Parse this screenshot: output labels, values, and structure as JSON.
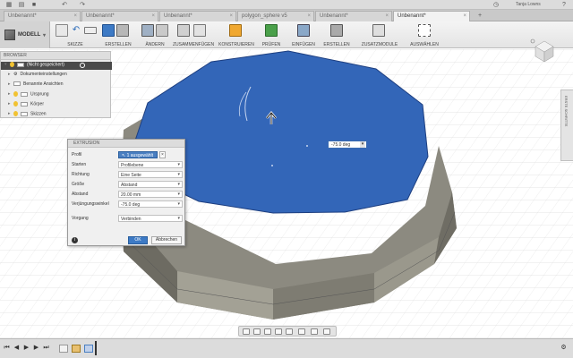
{
  "user_name": "Tanja Lowns",
  "tabs": [
    {
      "label": "Unbenannt*",
      "active": false
    },
    {
      "label": "Unbenannt*",
      "active": false
    },
    {
      "label": "Unbenannt*",
      "active": false
    },
    {
      "label": "polygon_sphere v5",
      "active": false
    },
    {
      "label": "Unbenannt*",
      "active": false
    },
    {
      "label": "Unbenannt*",
      "active": true
    }
  ],
  "toolbar": {
    "workspace": "MODELL",
    "groups": [
      "SKIZZE",
      "ERSTELLEN",
      "ÄNDERN",
      "ZUSAMMENFÜGEN",
      "KONSTRUIEREN",
      "PRÜFEN",
      "EINFÜGEN",
      "ERSTELLEN",
      "ZUSATZMODULE",
      "AUSWÄHLEN"
    ]
  },
  "browser": {
    "title": "BROWSER",
    "root": "(Nicht gespeichert)",
    "items": [
      "Dokumenteinstellungen",
      "Benannte Ansichten",
      "Ursprung",
      "Körper",
      "Skizzen"
    ]
  },
  "dialog": {
    "title": "EXTRUSION",
    "rows": [
      {
        "label": "Profil",
        "value": "1 ausgewählt"
      },
      {
        "label": "Starten",
        "value": "Profilebene"
      },
      {
        "label": "Richtung",
        "value": "Eine Seite"
      },
      {
        "label": "Größe",
        "value": "Abstand"
      },
      {
        "label": "Abstand",
        "value": "20.00 mm"
      },
      {
        "label": "Verjüngungswinkel",
        "value": "-75.0 deg"
      },
      {
        "label": "Vorgang",
        "value": "Verbinden"
      }
    ],
    "ok": "OK",
    "cancel": "Abbrechen"
  },
  "viewport": {
    "angle_input": "-75.0 deg",
    "right_panel": "ERSTE SCHRITTE"
  },
  "colors": {
    "face_blue": "#3366b8",
    "side_gray": "#8c8a80",
    "accent": "#3d7ac5"
  }
}
